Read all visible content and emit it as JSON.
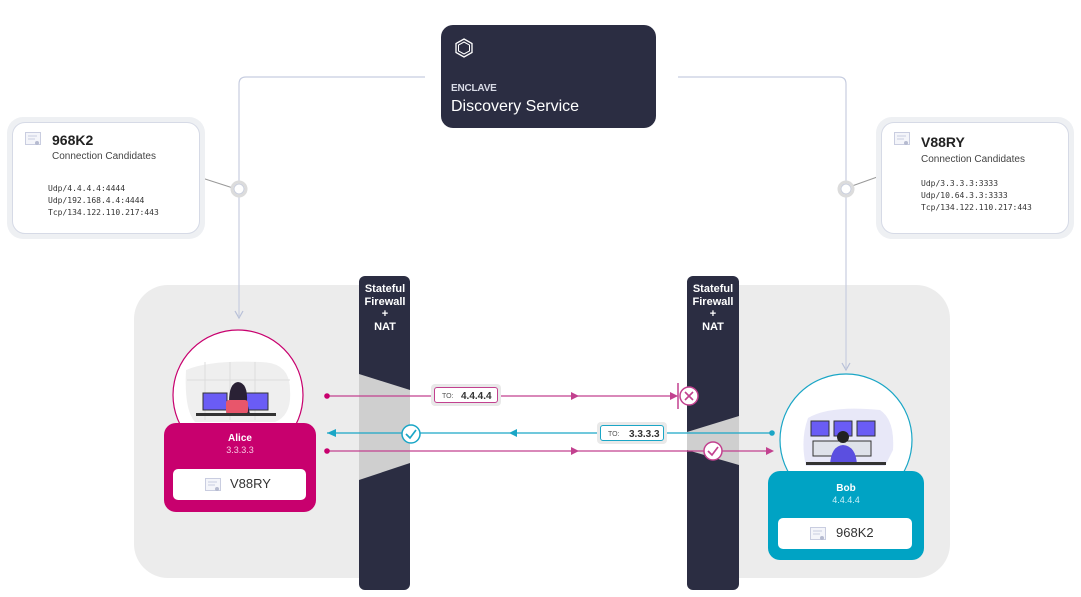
{
  "discovery_service": {
    "brand": "ENCLAVE",
    "title": "Discovery Service",
    "icon": "hexagon-logo-icon"
  },
  "candidates": {
    "left": {
      "name": "968K2",
      "subtitle": "Connection Candidates",
      "addresses": [
        "Udp/4.4.4.4:4444",
        "Udp/192.168.4.4:4444",
        "Tcp/134.122.110.217:443"
      ],
      "icon": "certificate-icon"
    },
    "right": {
      "name": "V88RY",
      "subtitle": "Connection Candidates",
      "addresses": [
        "Udp/3.3.3.3:3333",
        "Udp/10.64.3.3:3333",
        "Tcp/134.122.110.217:443"
      ],
      "icon": "certificate-icon"
    }
  },
  "firewalls": {
    "left": {
      "label_lines": [
        "Stateful",
        "Firewall +",
        "NAT"
      ]
    },
    "right": {
      "label_lines": [
        "Stateful",
        "Firewall +",
        "NAT"
      ]
    }
  },
  "nodes": {
    "alice": {
      "name": "Alice",
      "ip": "3.3.3.3",
      "key": "V88RY",
      "color": "#c8006e"
    },
    "bob": {
      "name": "Bob",
      "ip": "4.4.4.4",
      "key": "968K2",
      "color": "#00a3c4"
    }
  },
  "packets": {
    "to_bob": {
      "prefix": "TO:",
      "ip": "4.4.4.4",
      "status": "blocked"
    },
    "to_alice": {
      "prefix": "TO:",
      "ip": "3.3.3.3",
      "status": "allowed"
    },
    "second_to_bob": {
      "status": "allowed"
    }
  },
  "colors": {
    "dark": "#2b2d42",
    "magenta": "#c8006e",
    "magenta_line": "#c2418f",
    "cyan": "#1aa6c6",
    "connector": "#c7cde0"
  }
}
